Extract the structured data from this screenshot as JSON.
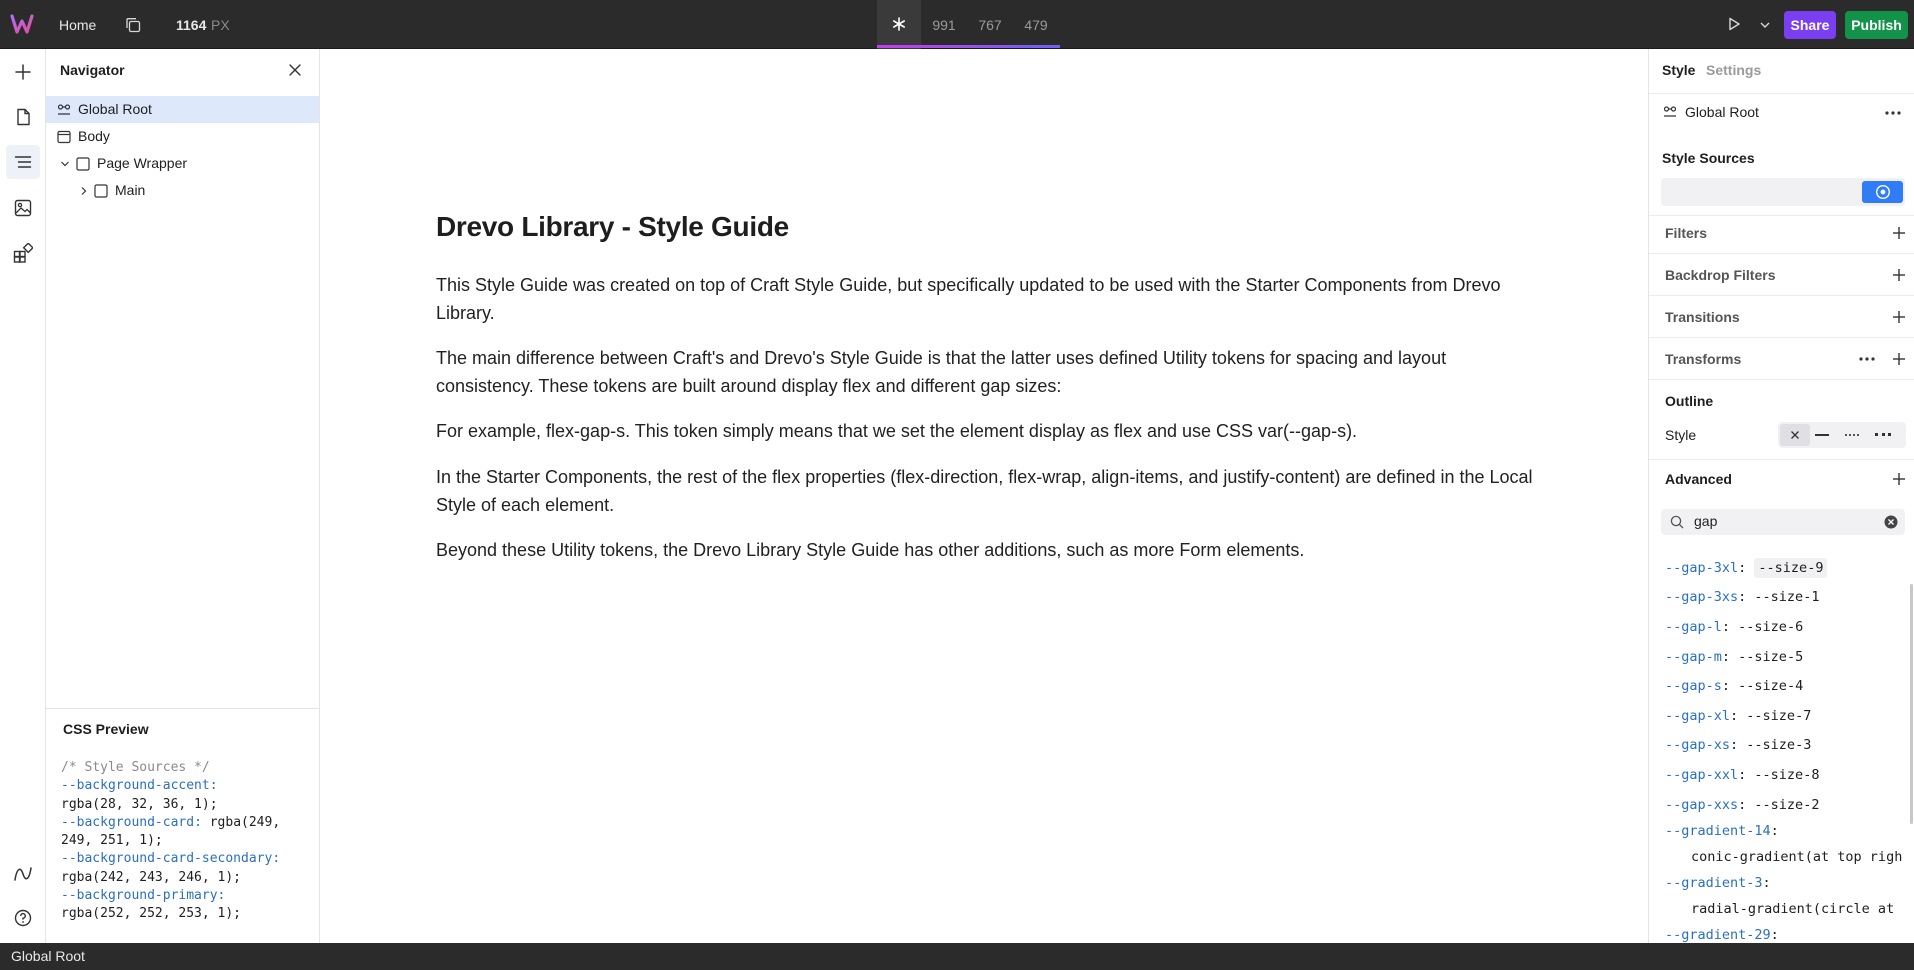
{
  "topbar": {
    "page_name": "Home",
    "width_value": "1164",
    "width_unit": "PX",
    "breakpoints": [
      "991",
      "767",
      "479"
    ],
    "share_label": "Share",
    "publish_label": "Publish",
    "accent_colors": {
      "share": "#7b3ff2",
      "publish": "#13924a",
      "breakpoint_bar": "#8a5cf6"
    }
  },
  "navigator": {
    "title": "Navigator",
    "items": [
      {
        "label": "Global Root",
        "icon": "global-root-icon",
        "selected": true
      },
      {
        "label": "Body",
        "icon": "body-icon"
      },
      {
        "label": "Page Wrapper",
        "icon": "box-icon",
        "expanded": true
      },
      {
        "label": "Main",
        "icon": "box-icon",
        "expanded": false
      }
    ]
  },
  "css_preview": {
    "title": "CSS Preview",
    "comment": "/* Style Sources */",
    "lines": [
      {
        "prop": "--background-accent",
        "sep": ":",
        "val": "rgba(28, 32, 36, 1);"
      },
      {
        "prop": "--background-card",
        "sep": ": ",
        "val_inline": "rgba(249,",
        "val": "249, 251, 1);"
      },
      {
        "prop": "--background-card-secondary",
        "sep": ":",
        "val": "rgba(242, 243, 246, 1);"
      },
      {
        "prop": "--background-primary",
        "sep": ":",
        "val": "rgba(252, 252, 253, 1);"
      }
    ]
  },
  "canvas": {
    "title": "Drevo Library - Style Guide",
    "paragraphs": [
      "This Style Guide was created on top of Craft Style Guide, but specifically updated to be used with the Starter Components from Drevo Library.",
      "The main difference between Craft's and Drevo's Style Guide is that the latter uses defined Utility tokens for spacing and layout consistency. These tokens are built around display flex and different gap sizes:",
      "For example, flex-gap-s. This token simply means that we set the element display as flex and use CSS var(--gap-s).",
      "In the Starter Components, the rest of the flex properties (flex-direction, flex-wrap, align-items, and justify-content) are defined in the Local Style of each element.",
      "Beyond these Utility tokens, the Drevo Library Style Guide has other additions, such as more Form elements."
    ]
  },
  "right_panel": {
    "tabs": [
      "Style",
      "Settings"
    ],
    "element": "Global Root",
    "style_sources_label": "Style Sources",
    "sections": [
      "Filters",
      "Backdrop Filters",
      "Transitions",
      "Transforms"
    ],
    "outline_label": "Outline",
    "outline_style_label": "Style",
    "advanced_label": "Advanced",
    "search_value": "gap",
    "variables": [
      {
        "name": "--gap-3xl",
        "value": "--size-9"
      },
      {
        "name": "--gap-3xs",
        "value": "--size-1"
      },
      {
        "name": "--gap-l",
        "value": "--size-6"
      },
      {
        "name": "--gap-m",
        "value": "--size-5"
      },
      {
        "name": "--gap-s",
        "value": "--size-4"
      },
      {
        "name": "--gap-xl",
        "value": "--size-7"
      },
      {
        "name": "--gap-xs",
        "value": "--size-3"
      },
      {
        "name": "--gap-xxl",
        "value": "--size-8"
      },
      {
        "name": "--gap-xxs",
        "value": "--size-2"
      }
    ],
    "gradients": [
      {
        "name": "--gradient-14",
        "value": "conic-gradient(at top righ"
      },
      {
        "name": "--gradient-3",
        "value": "radial-gradient(circle at"
      },
      {
        "name": "--gradient-29",
        "value": ""
      }
    ]
  },
  "status_bar": {
    "label": "Global Root"
  }
}
